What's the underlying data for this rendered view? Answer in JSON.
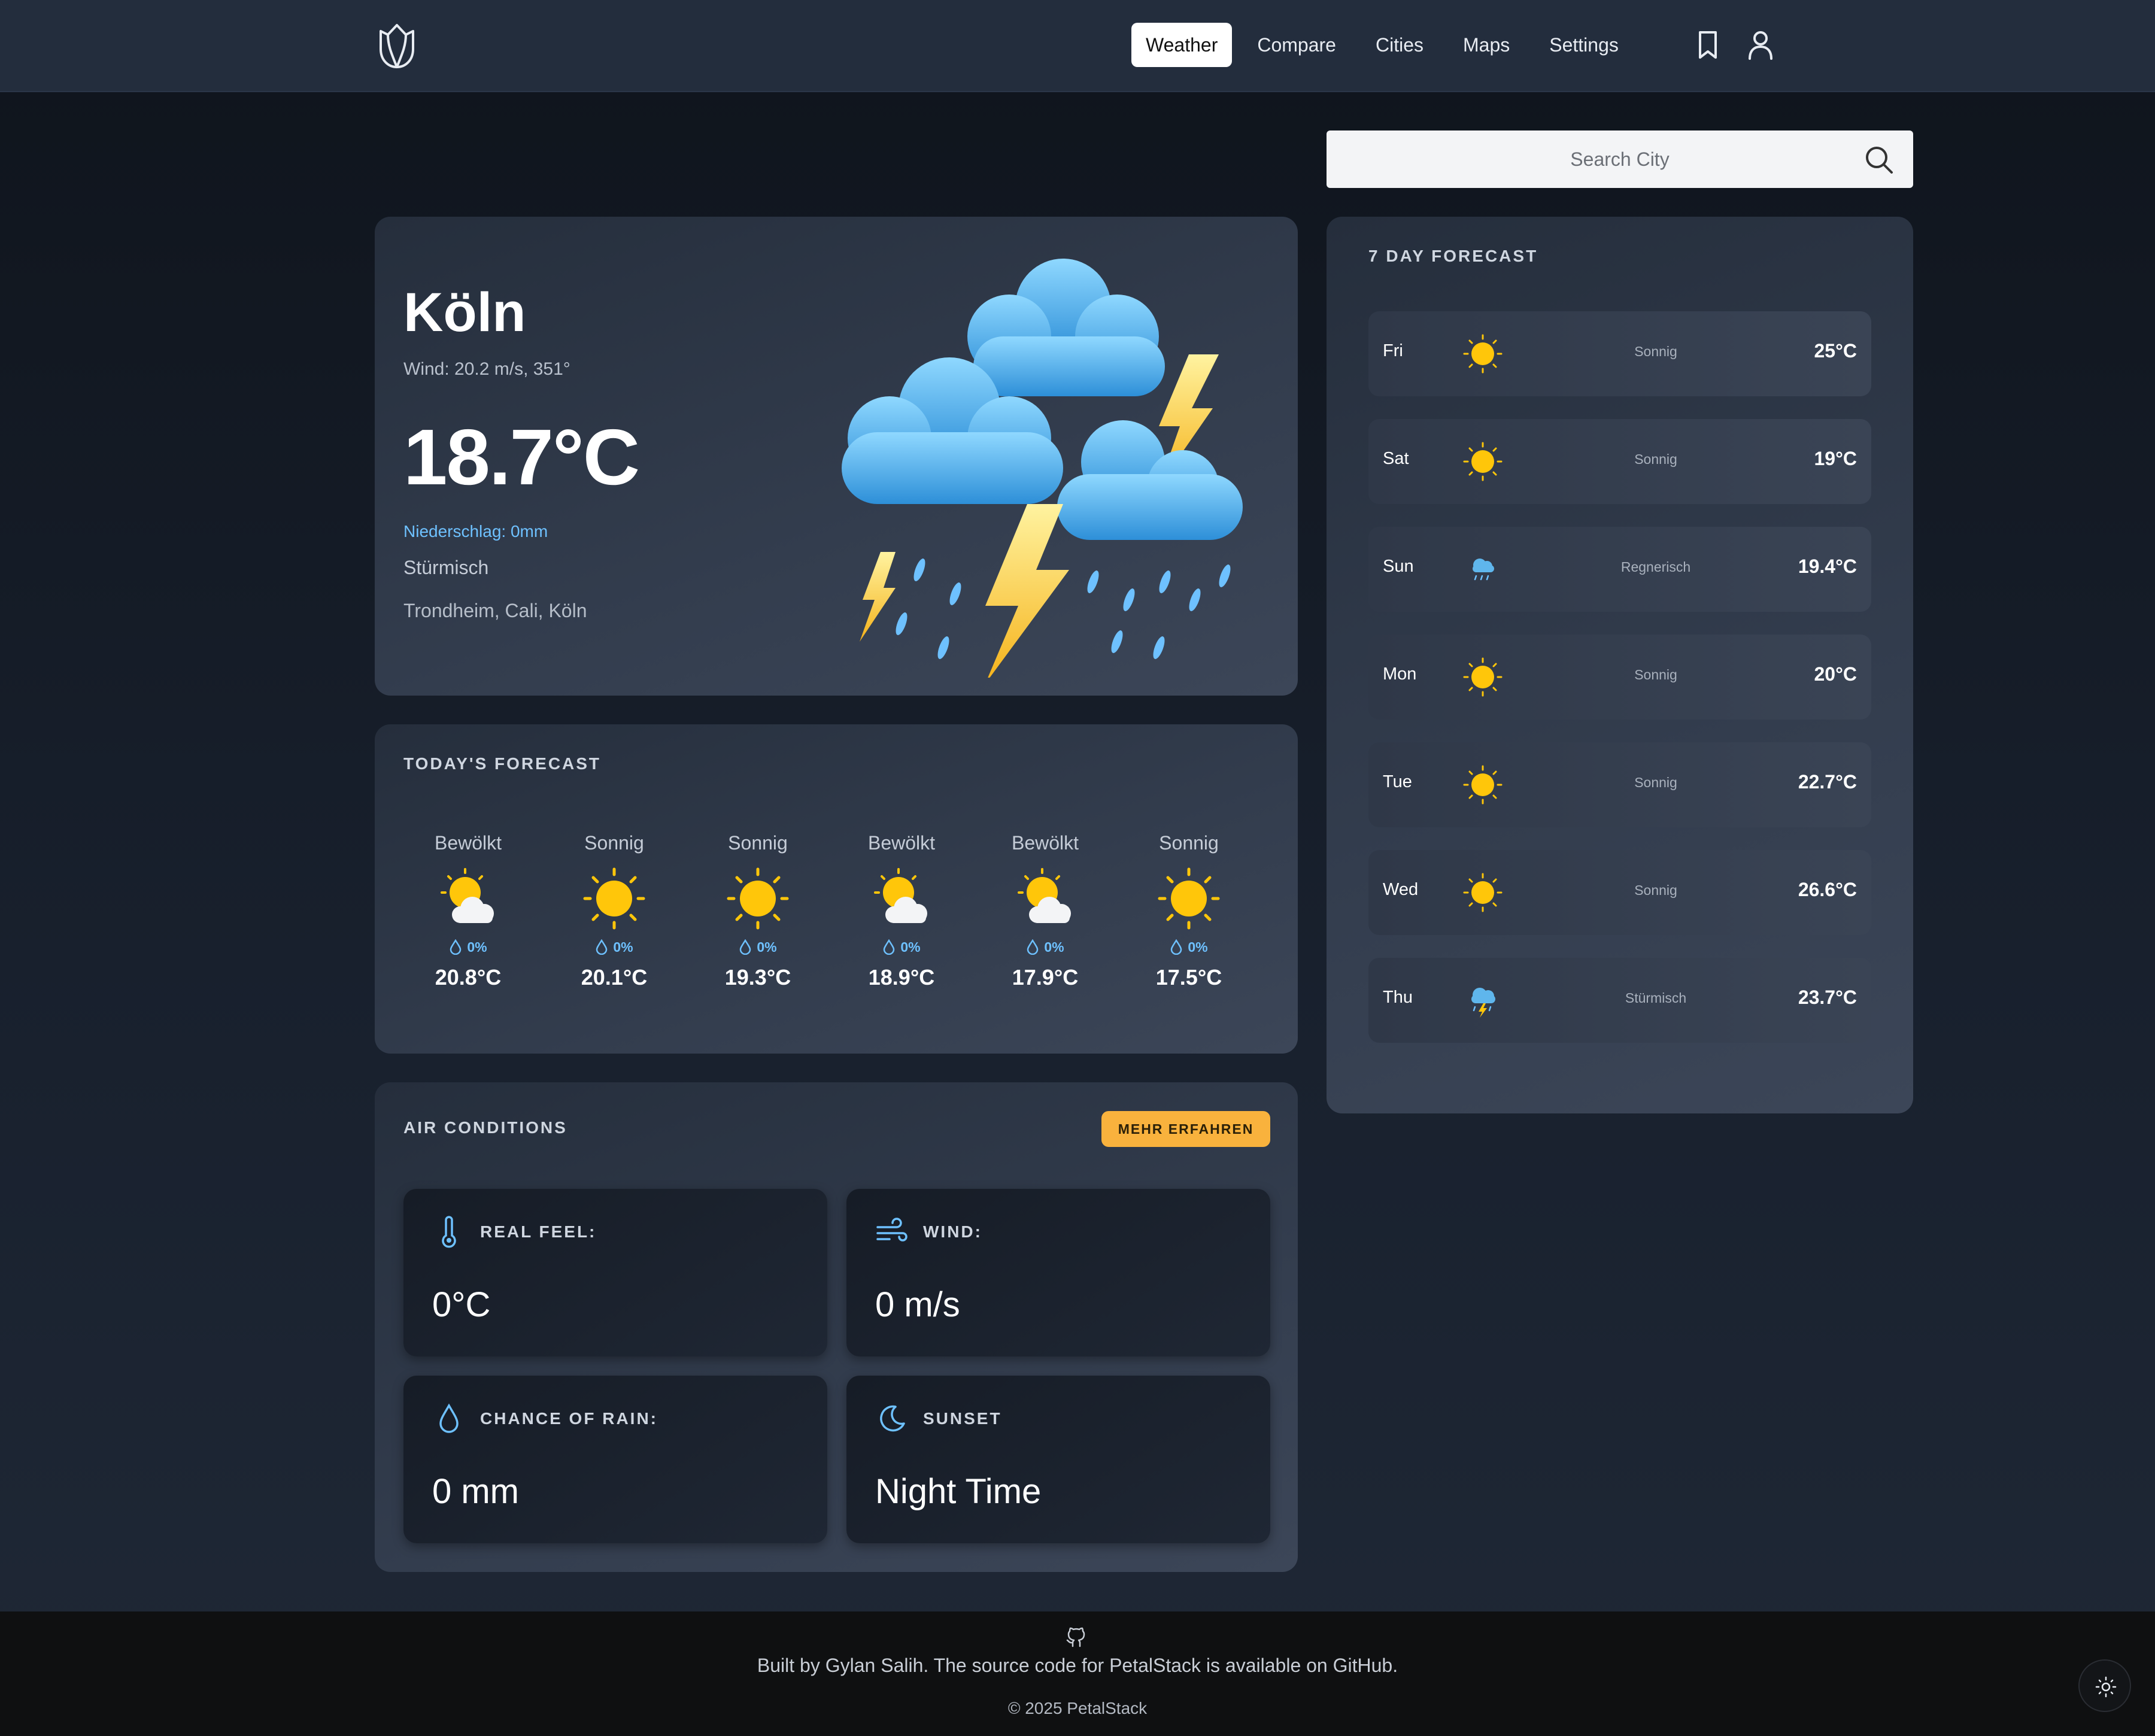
{
  "nav": {
    "links": [
      {
        "label": "Weather",
        "active": true
      },
      {
        "label": "Compare"
      },
      {
        "label": "Cities"
      },
      {
        "label": "Maps"
      },
      {
        "label": "Settings"
      }
    ],
    "icons": [
      "tulip-logo-icon",
      "bookmark-icon",
      "user-icon"
    ]
  },
  "search": {
    "placeholder": "Search City"
  },
  "current": {
    "city": "Köln",
    "wind": "Wind: 20.2 m/s, 351°",
    "temp": "18.7°C",
    "precipitation": "Niederschlag: 0mm",
    "condition": "Stürmisch",
    "recent": "Trondheim, Cali, Köln",
    "illustration": "thunderstorm-icon"
  },
  "today": {
    "title": "TODAY'S FORECAST",
    "hours": [
      {
        "condition": "Bewölkt",
        "icon": "partly-cloudy-icon",
        "rain": "0%",
        "temp": "20.8°C"
      },
      {
        "condition": "Sonnig",
        "icon": "sun-icon",
        "rain": "0%",
        "temp": "20.1°C"
      },
      {
        "condition": "Sonnig",
        "icon": "sun-icon",
        "rain": "0%",
        "temp": "19.3°C"
      },
      {
        "condition": "Bewölkt",
        "icon": "partly-cloudy-icon",
        "rain": "0%",
        "temp": "18.9°C"
      },
      {
        "condition": "Bewölkt",
        "icon": "partly-cloudy-icon",
        "rain": "0%",
        "temp": "17.9°C"
      },
      {
        "condition": "Sonnig",
        "icon": "sun-icon",
        "rain": "0%",
        "temp": "17.5°C"
      }
    ]
  },
  "air": {
    "title": "AIR CONDITIONS",
    "more_button": "MEHR ERFAHREN",
    "tiles": [
      {
        "label": "REAL FEEL:",
        "value": "0°C",
        "icon": "thermometer-icon"
      },
      {
        "label": "WIND:",
        "value": "0 m/s",
        "icon": "wind-icon"
      },
      {
        "label": "CHANCE OF RAIN:",
        "value": "0 mm",
        "icon": "droplet-icon"
      },
      {
        "label": "SUNSET",
        "value": "Night Time",
        "icon": "moon-icon"
      }
    ]
  },
  "week": {
    "title": "7 DAY FORECAST",
    "days": [
      {
        "day": "Fri",
        "icon": "sun-icon",
        "condition": "Sonnig",
        "temp": "25°C"
      },
      {
        "day": "Sat",
        "icon": "sun-icon",
        "condition": "Sonnig",
        "temp": "19°C"
      },
      {
        "day": "Sun",
        "icon": "rain-cloud-icon",
        "condition": "Regnerisch",
        "temp": "19.4°C"
      },
      {
        "day": "Mon",
        "icon": "sun-icon",
        "condition": "Sonnig",
        "temp": "20°C"
      },
      {
        "day": "Tue",
        "icon": "sun-icon",
        "condition": "Sonnig",
        "temp": "22.7°C"
      },
      {
        "day": "Wed",
        "icon": "sun-icon",
        "condition": "Sonnig",
        "temp": "26.6°C"
      },
      {
        "day": "Thu",
        "icon": "storm-cloud-icon",
        "condition": "Stürmisch",
        "temp": "23.7°C"
      }
    ]
  },
  "footer": {
    "built_by": "Built by Gylan Salih. The source code for PetalStack is available on GitHub.",
    "copyright": "© 2025 PetalStack"
  },
  "colors": {
    "accent_button": "#f9b23d",
    "rain_blue": "#6ec1ff",
    "sun_yellow": "#ffc60a",
    "nav_bg": "#232d3d"
  }
}
